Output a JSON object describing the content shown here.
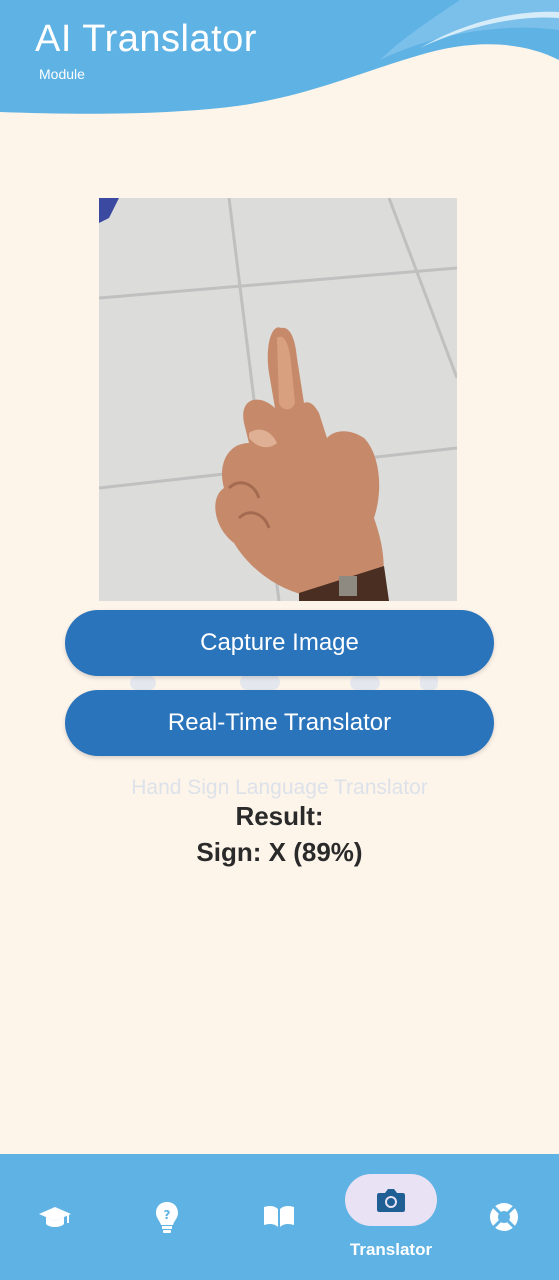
{
  "header": {
    "title": "AI Translator",
    "subtitle": "Module"
  },
  "colors": {
    "background": "#fdf4ea",
    "header_blue": "#5fb2e4",
    "button_blue": "#2a74bc",
    "nav_active_pill": "#e8e2f4"
  },
  "preview": {
    "image_description": "hand-sign-photo"
  },
  "actions": {
    "capture_label": "Capture Image",
    "realtime_label": "Real-Time Translator"
  },
  "watermark": {
    "text": "Hand Sign Language Translator"
  },
  "result": {
    "heading": "Result:",
    "value": "Sign: X (89%)"
  },
  "nav": {
    "items": [
      {
        "icon": "graduation-cap-icon",
        "label": ""
      },
      {
        "icon": "lightbulb-icon",
        "label": ""
      },
      {
        "icon": "book-icon",
        "label": ""
      },
      {
        "icon": "camera-icon",
        "label": "Translator",
        "active": true
      },
      {
        "icon": "lifebuoy-icon",
        "label": ""
      }
    ]
  }
}
